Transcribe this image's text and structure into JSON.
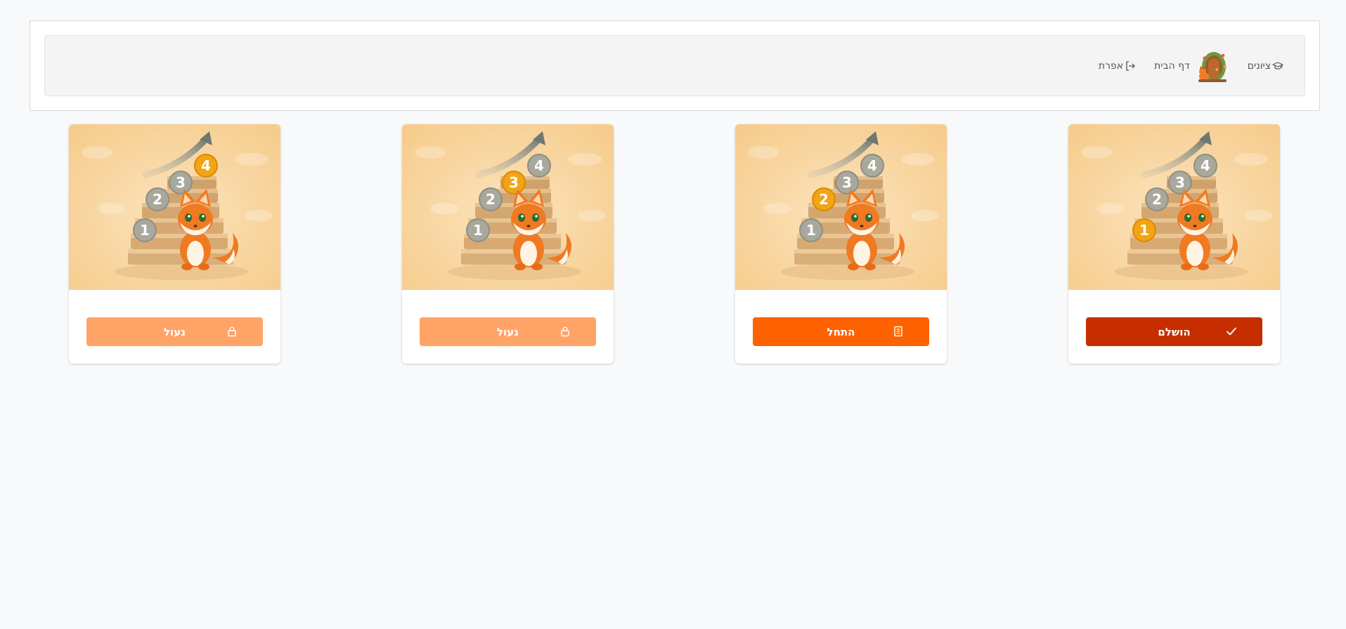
{
  "nav": {
    "exit_label": "אפרת",
    "home_label": "דף הבית",
    "grades_label": "ציונים"
  },
  "cards": [
    {
      "active_step": 1,
      "step_numbers": [
        "1",
        "2",
        "3",
        "4"
      ],
      "button_label": "הושלם",
      "button_icon": "check-icon",
      "status": "completed",
      "button_color": "#c62e00"
    },
    {
      "active_step": 2,
      "step_numbers": [
        "1",
        "2",
        "3",
        "4"
      ],
      "button_label": "התחל",
      "button_icon": "document-icon",
      "status": "start",
      "button_color": "#ff6200"
    },
    {
      "active_step": 3,
      "step_numbers": [
        "1",
        "2",
        "3",
        "4"
      ],
      "button_label": "נעול",
      "button_icon": "lock-icon",
      "status": "locked",
      "button_color": "#ffa366"
    },
    {
      "active_step": 4,
      "step_numbers": [
        "1",
        "2",
        "3",
        "4"
      ],
      "button_label": "נעול",
      "button_icon": "lock-icon",
      "status": "locked",
      "button_color": "#ffa366"
    }
  ],
  "colors": {
    "active_coin": "#f3a413",
    "inactive_coin": "#a8a89c",
    "background": "#f8f9fb"
  }
}
